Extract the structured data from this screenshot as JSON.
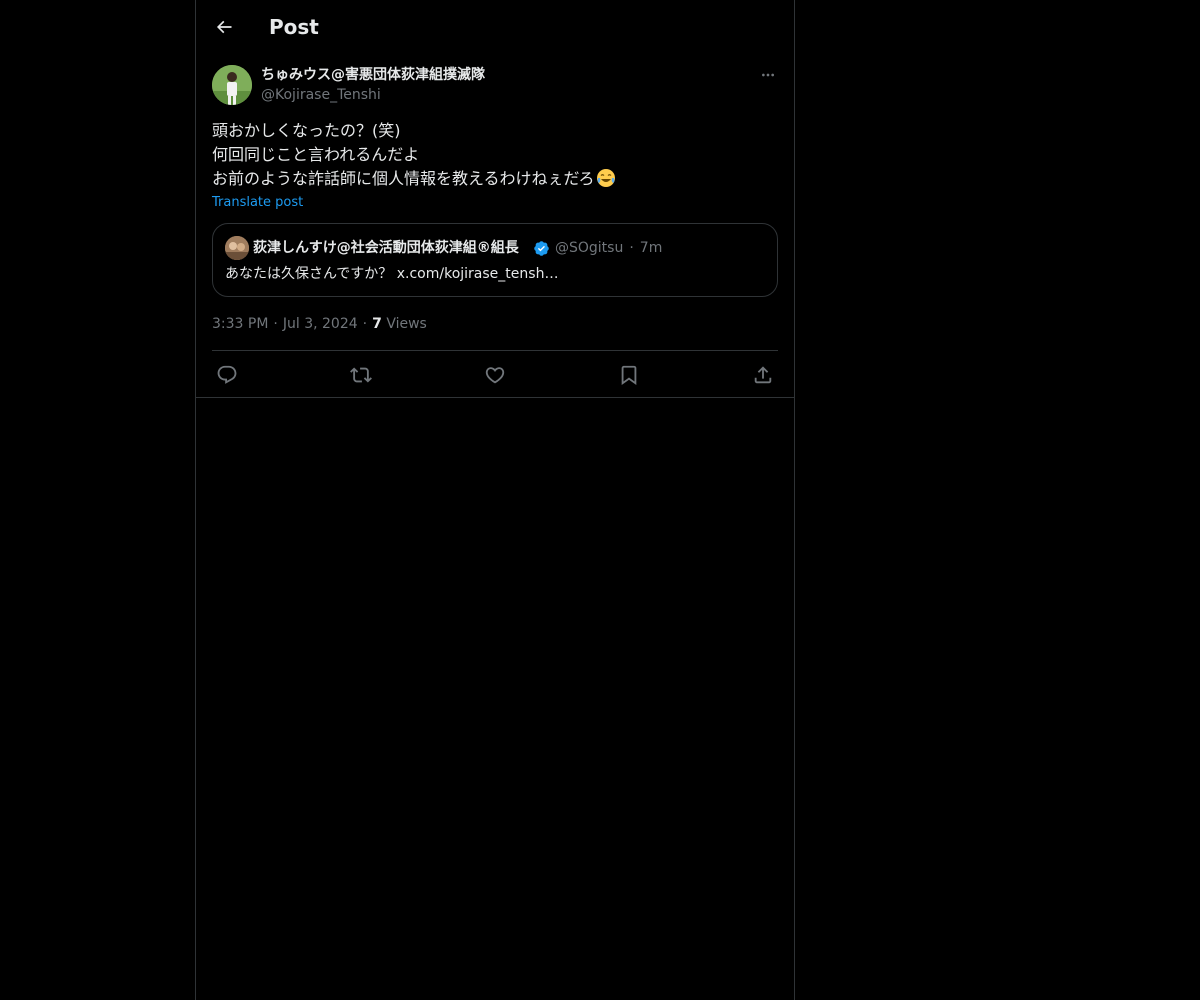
{
  "header": {
    "title": "Post",
    "back_icon": "arrow-left-icon"
  },
  "post": {
    "author": {
      "display_name": "ちゅみウス@害悪団体荻津組撲滅隊",
      "handle": "@Kojirase_Tenshi"
    },
    "text_lines": [
      "頭おかしくなったの？(笑)",
      "何回同じこと言われるんだよ",
      "お前のような詐話師に個人情報を教えるわけねぇだろ"
    ],
    "emoji_icon": "face-with-tears-of-joy-icon",
    "translate_label": "Translate post",
    "quote": {
      "display_name": "荻津しんすけ@社会活動団体荻津組®組長",
      "verified_icon": "verified-badge-icon",
      "handle": "@SOgitsu",
      "time": "7m",
      "text": "あなたは久保さんですか？ x.com/kojirase_tensh…"
    },
    "timestamp": {
      "time": "3:33 PM",
      "date": "Jul 3, 2024",
      "views_count": "7",
      "views_label": "Views"
    }
  },
  "actions": [
    "reply-icon",
    "repost-icon",
    "like-icon",
    "bookmark-icon",
    "share-icon"
  ],
  "colors": {
    "background": "#000000",
    "text": "#e7e9ea",
    "secondary_text": "#71767b",
    "accent": "#1d9bf0",
    "border": "#2f3336"
  }
}
